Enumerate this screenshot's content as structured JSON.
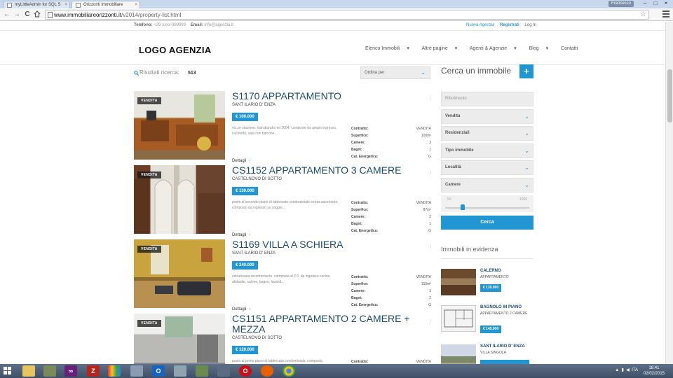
{
  "browser": {
    "tabs": [
      {
        "title": "myLittleAdmin for SQL S",
        "close": "×"
      },
      {
        "title": "Orizzonti Immobiliare",
        "close": "×"
      }
    ],
    "user_badge": "Francesco",
    "window_controls": {
      "minimize": "–",
      "maximize": "□",
      "close": "×"
    },
    "nav": {
      "back": "←",
      "forward": "→",
      "reload": "C"
    },
    "url_host": "www.immobiliareorizzonti.it",
    "url_path": "/v2014/property-list.html",
    "star": "☆"
  },
  "topbar": {
    "phone_label": "Telefono:",
    "phone": "+39 xxxx-999999",
    "email_label": "Email:",
    "email": "info@agenzia.it",
    "new_agency": "Nuova Agenzia",
    "register": "Registrati",
    "login": "Log In"
  },
  "header": {
    "logo": "LOGO AGENZIA",
    "nav": [
      "Elenco Immobili",
      "Altre pagine",
      "Agenti & Agenzie",
      "Blog",
      "Contatti"
    ],
    "nav_caret": "▾"
  },
  "results": {
    "label": "Risultati ricerca:",
    "count": "513",
    "sort_label": "Ordina per",
    "chevron": "⌄"
  },
  "spec_labels": {
    "contract": "Contratto:",
    "surface": "Superfice:",
    "rooms": "Camere:",
    "baths": "Bagni:",
    "energy": "Cat. Energetica:"
  },
  "listings": [
    {
      "badge": "VENDITA",
      "title": "S1170 APPARTAMENTO",
      "place": "SANT ILARIO D' ENZA",
      "price": "€ 100.000",
      "description": "vic.ze stazione, ristrutturato nel 2004, composto da ampio ingresso, cucinotto, sala con balcone,...",
      "contract": "VENDITA",
      "surface": "100m²",
      "rooms": "3",
      "baths": "1",
      "energy": "G",
      "details": "Dettagli",
      "sep": "|"
    },
    {
      "badge": "VENDITA",
      "title": "CS1152 APPARTAMENTO 3 CAMERE",
      "place": "CASTELNOVO DI SOTTO",
      "price": "€ 130.000",
      "description": "posto al secondo piano di fabbricato condominiale senza ascensore, composto da ingresso su soggio...",
      "contract": "VENDITA",
      "surface": "87m²",
      "rooms": "2",
      "baths": "1",
      "energy": "G",
      "details": "Dettagli",
      "sep": "|"
    },
    {
      "badge": "VENDITA",
      "title": "S1169 VILLA A SCHIERA",
      "place": "SANT ILARIO D' ENZA",
      "price": "€ 240.000",
      "description": "ristrutturata recentemente, composta al P.T. da ingresso cucina abitabile, salone, bagno, lavand...",
      "contract": "VENDITA",
      "surface": "150m²",
      "rooms": "3",
      "baths": "2",
      "energy": "G",
      "details": "Dettagli",
      "sep": "|"
    },
    {
      "badge": "VENDITA",
      "title": "CS1151 APPARTAMENTO 2 CAMERE + MEZZA",
      "place": "CASTELNOVO DI SOTTO",
      "price": "€ 120.000",
      "description": "posto al primo piano di fabbricato condominiale, composta",
      "contract": "VENDITA",
      "surface": "",
      "rooms": "",
      "baths": "",
      "energy": "",
      "details": "",
      "sep": "|"
    }
  ],
  "sidebar": {
    "title": "Cerca un immobile",
    "plus": "+",
    "reference_placeholder": "Riferimento",
    "fields": [
      "Vendita",
      "Residenziali",
      "Tipo immobile",
      "Località",
      "Camere"
    ],
    "chevron": "⌄",
    "slider_min": "50",
    "slider_max": "1000",
    "search_button": "Cerca",
    "featured_title": "Immobili in evidenza",
    "featured": [
      {
        "name": "CALERNO",
        "type": "APPARTAMENTO",
        "price": "€ 135.000"
      },
      {
        "name": "BAGNOLO IN PIANO",
        "type": "APPARTAMENTO 2 CAMERE",
        "price": "€ 145.000"
      },
      {
        "name": "SANT ILARIO D' ENZA",
        "type": "VILLA SINGOLA",
        "price": ""
      }
    ]
  },
  "taskbar": {
    "apps": [
      "explorer",
      "app2",
      "visual-studio",
      "filezilla",
      "paint",
      "app6",
      "outlook",
      "app8",
      "app9",
      "app10",
      "opera",
      "firefox",
      "chrome"
    ],
    "language": "ITA",
    "time": "18:41",
    "date": "02/02/2015"
  },
  "colors": {
    "accent": "#2196d3",
    "title_text": "#1a4a6e",
    "taskbar": "#3e4f66"
  }
}
